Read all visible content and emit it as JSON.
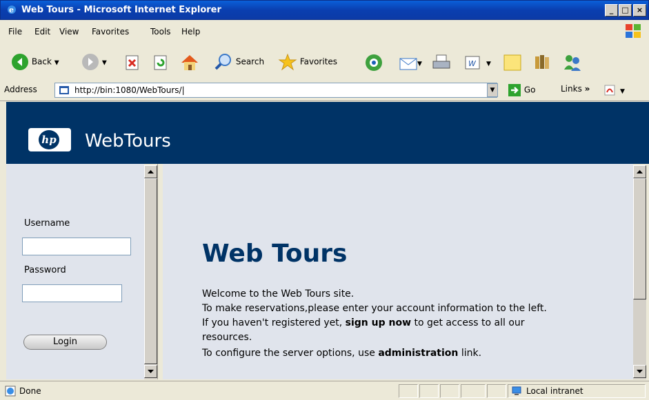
{
  "window": {
    "title": "Web Tours - Microsoft Internet Explorer",
    "controls": [
      "_",
      "□",
      "×"
    ]
  },
  "menu": [
    "File",
    "Edit",
    "View",
    "Favorites",
    "Tools",
    "Help"
  ],
  "toolbar": {
    "back": "Back",
    "search": "Search",
    "favorites": "Favorites"
  },
  "address": {
    "label": "Address",
    "url": "http://bin:1080/WebTours/|",
    "go": "Go",
    "links": "Links"
  },
  "banner": {
    "logo_text": "hp",
    "brand": "WebTours"
  },
  "login": {
    "username_label": "Username",
    "password_label": "Password",
    "username_value": "",
    "password_value": "",
    "login_button": "Login"
  },
  "main": {
    "heading": "Web Tours",
    "lines": {
      "l1": "Welcome to the Web Tours site.",
      "l2": "To make reservations,please enter your account information to the left.",
      "l3_pre": "If you haven't registered yet, ",
      "l3_link": "sign up now",
      "l3_post": " to get access to all our",
      "l4": "resources.",
      "l5_pre": "To configure the server options, use ",
      "l5_link": "administration",
      "l5_post": " link."
    }
  },
  "status": {
    "text": "Done",
    "zone": "Local intranet"
  },
  "colors": {
    "banner": "#003366",
    "heading": "#003366",
    "page_bg": "#e0e4ec"
  }
}
